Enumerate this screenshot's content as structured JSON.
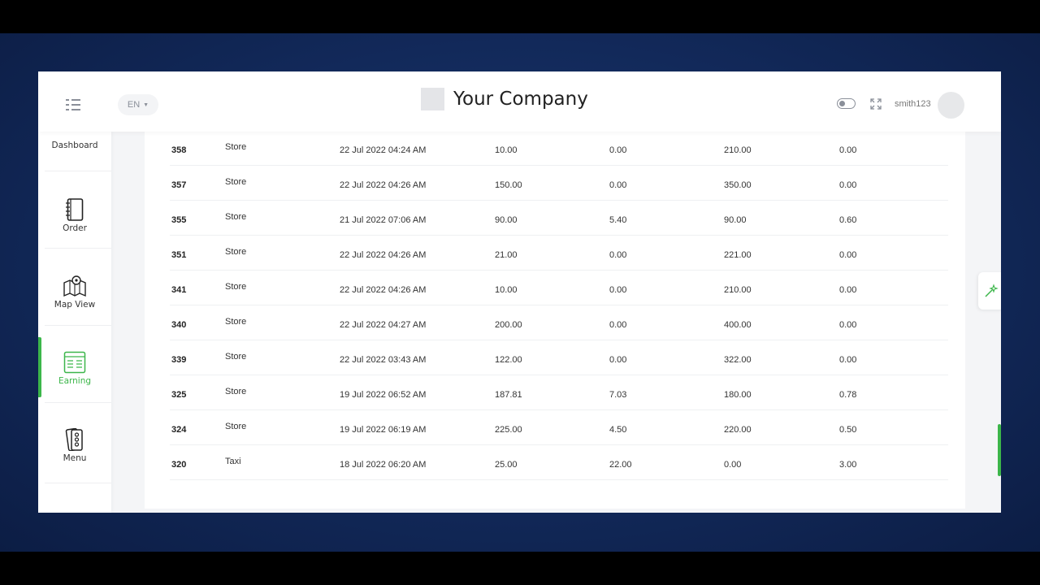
{
  "header": {
    "language": "EN",
    "company_name": "Your Company",
    "username": "smith123"
  },
  "sidebar": {
    "items": [
      {
        "label": "Dashboard"
      },
      {
        "label": "Order"
      },
      {
        "label": "Map View"
      },
      {
        "label": "Earning",
        "active": true
      },
      {
        "label": "Menu"
      }
    ]
  },
  "earnings": {
    "rows": [
      {
        "id": "358",
        "type": "Store",
        "date": "22 Jul 2022 04:24 AM",
        "v1": "10.00",
        "v2": "0.00",
        "v3": "210.00",
        "v4": "0.00"
      },
      {
        "id": "357",
        "type": "Store",
        "date": "22 Jul 2022 04:26 AM",
        "v1": "150.00",
        "v2": "0.00",
        "v3": "350.00",
        "v4": "0.00"
      },
      {
        "id": "355",
        "type": "Store",
        "date": "21 Jul 2022 07:06 AM",
        "v1": "90.00",
        "v2": "5.40",
        "v3": "90.00",
        "v4": "0.60"
      },
      {
        "id": "351",
        "type": "Store",
        "date": "22 Jul 2022 04:26 AM",
        "v1": "21.00",
        "v2": "0.00",
        "v3": "221.00",
        "v4": "0.00"
      },
      {
        "id": "341",
        "type": "Store",
        "date": "22 Jul 2022 04:26 AM",
        "v1": "10.00",
        "v2": "0.00",
        "v3": "210.00",
        "v4": "0.00"
      },
      {
        "id": "340",
        "type": "Store",
        "date": "22 Jul 2022 04:27 AM",
        "v1": "200.00",
        "v2": "0.00",
        "v3": "400.00",
        "v4": "0.00"
      },
      {
        "id": "339",
        "type": "Store",
        "date": "22 Jul 2022 03:43 AM",
        "v1": "122.00",
        "v2": "0.00",
        "v3": "322.00",
        "v4": "0.00"
      },
      {
        "id": "325",
        "type": "Store",
        "date": "19 Jul 2022 06:52 AM",
        "v1": "187.81",
        "v2": "7.03",
        "v3": "180.00",
        "v4": "0.78"
      },
      {
        "id": "324",
        "type": "Store",
        "date": "19 Jul 2022 06:19 AM",
        "v1": "225.00",
        "v2": "4.50",
        "v3": "220.00",
        "v4": "0.50"
      },
      {
        "id": "320",
        "type": "Taxi",
        "date": "18 Jul 2022 06:20 AM",
        "v1": "25.00",
        "v2": "22.00",
        "v3": "0.00",
        "v4": "3.00"
      }
    ]
  },
  "colors": {
    "accent": "#3cb64a",
    "backdrop": "#12295a"
  },
  "icons": {
    "menu": "menu-toggle-icon",
    "fullscreen": "expand-icon",
    "settings": "magic-wand-icon"
  }
}
